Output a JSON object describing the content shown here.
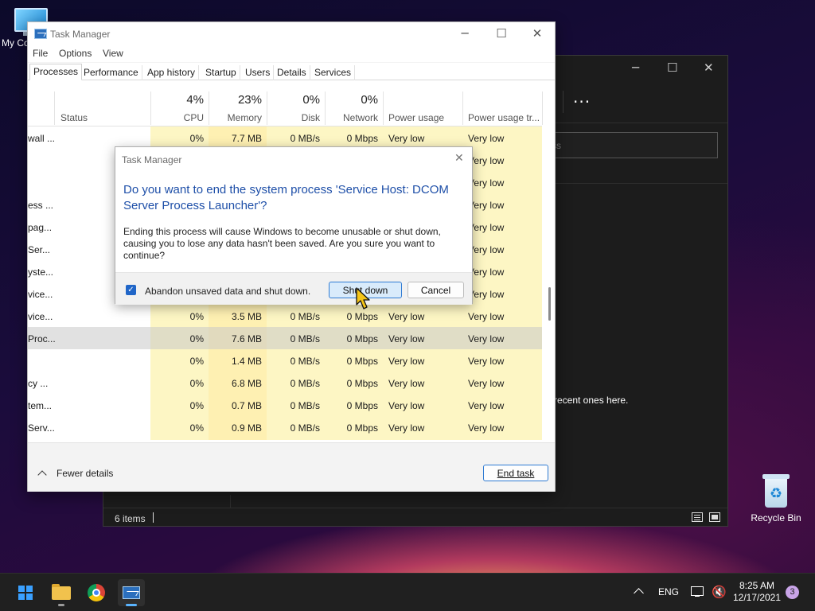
{
  "desktop": {
    "my_computer_label": "My Co",
    "recycle_bin_label": "Recycle Bin"
  },
  "explorer": {
    "search_placeholder": "ss",
    "empty_message": "recent ones here.",
    "status_count": "6 items",
    "more_icon": "more-icon"
  },
  "task_manager": {
    "title": "Task Manager",
    "menu": [
      "File",
      "Options",
      "View"
    ],
    "tabs": [
      "Processes",
      "Performance",
      "App history",
      "Startup",
      "Users",
      "Details",
      "Services"
    ],
    "active_tab": "Processes",
    "columns": {
      "status": "Status",
      "cpu_pct": "4%",
      "cpu": "CPU",
      "memory_pct": "23%",
      "memory": "Memory",
      "disk_pct": "0%",
      "disk": "Disk",
      "network_pct": "0%",
      "network": "Network",
      "power": "Power usage",
      "power_trend": "Power usage tr..."
    },
    "rows": [
      {
        "name": "wall ...",
        "cpu": "0%",
        "mem": "7.7 MB",
        "disk": "0 MB/s",
        "net": "0 Mbps",
        "power": "Very low",
        "trend": "Very low"
      },
      {
        "name": "",
        "cpu": "",
        "mem": "",
        "disk": "",
        "net": "",
        "power": "",
        "trend": "Very low"
      },
      {
        "name": "",
        "cpu": "",
        "mem": "",
        "disk": "",
        "net": "",
        "power": "",
        "trend": "Very low"
      },
      {
        "name": "ess ...",
        "cpu": "",
        "mem": "",
        "disk": "",
        "net": "",
        "power": "",
        "trend": "Very low"
      },
      {
        "name": "pag...",
        "cpu": "",
        "mem": "",
        "disk": "",
        "net": "",
        "power": "",
        "trend": "Very low"
      },
      {
        "name": "Ser...",
        "cpu": "",
        "mem": "",
        "disk": "",
        "net": "",
        "power": "",
        "trend": "Very low"
      },
      {
        "name": "yste...",
        "cpu": "",
        "mem": "",
        "disk": "",
        "net": "",
        "power": "",
        "trend": "Very low"
      },
      {
        "name": "vice...",
        "cpu": "",
        "mem": "",
        "disk": "",
        "net": "",
        "power": "",
        "trend": "Very low"
      },
      {
        "name": "vice...",
        "cpu": "0%",
        "mem": "3.5 MB",
        "disk": "0 MB/s",
        "net": "0 Mbps",
        "power": "Very low",
        "trend": "Very low"
      },
      {
        "name": "Proc...",
        "cpu": "0%",
        "mem": "7.6 MB",
        "disk": "0 MB/s",
        "net": "0 Mbps",
        "power": "Very low",
        "trend": "Very low"
      },
      {
        "name": "",
        "cpu": "0%",
        "mem": "1.4 MB",
        "disk": "0 MB/s",
        "net": "0 Mbps",
        "power": "Very low",
        "trend": "Very low"
      },
      {
        "name": "cy ...",
        "cpu": "0%",
        "mem": "6.8 MB",
        "disk": "0 MB/s",
        "net": "0 Mbps",
        "power": "Very low",
        "trend": "Very low"
      },
      {
        "name": "tem...",
        "cpu": "0%",
        "mem": "0.7 MB",
        "disk": "0 MB/s",
        "net": "0 Mbps",
        "power": "Very low",
        "trend": "Very low"
      },
      {
        "name": "Serv...",
        "cpu": "0%",
        "mem": "0.9 MB",
        "disk": "0 MB/s",
        "net": "0 Mbps",
        "power": "Very low",
        "trend": "Very low"
      }
    ],
    "selected_row": 9,
    "fewer_details": "Fewer details",
    "end_task": "End task"
  },
  "dialog": {
    "title": "Task Manager",
    "question": "Do you want to end the system process 'Service Host: DCOM Server Process Launcher'?",
    "body": "Ending this process will cause Windows to become unusable or shut down, causing you to lose any data hasn't been saved. Are you sure you want to continue?",
    "checkbox_label": "Abandon unsaved data and shut down.",
    "checkbox_checked": true,
    "shutdown_label": "Shut down",
    "cancel_label": "Cancel"
  },
  "taskbar": {
    "language": "ENG",
    "time": "8:25 AM",
    "date": "12/17/2021",
    "notification_count": "3"
  },
  "colors": {
    "accent": "#2f7bd3",
    "heat_light": "#fdf6c4",
    "heat_dark": "#fef0b2",
    "dialog_question": "#1e4fa8"
  }
}
